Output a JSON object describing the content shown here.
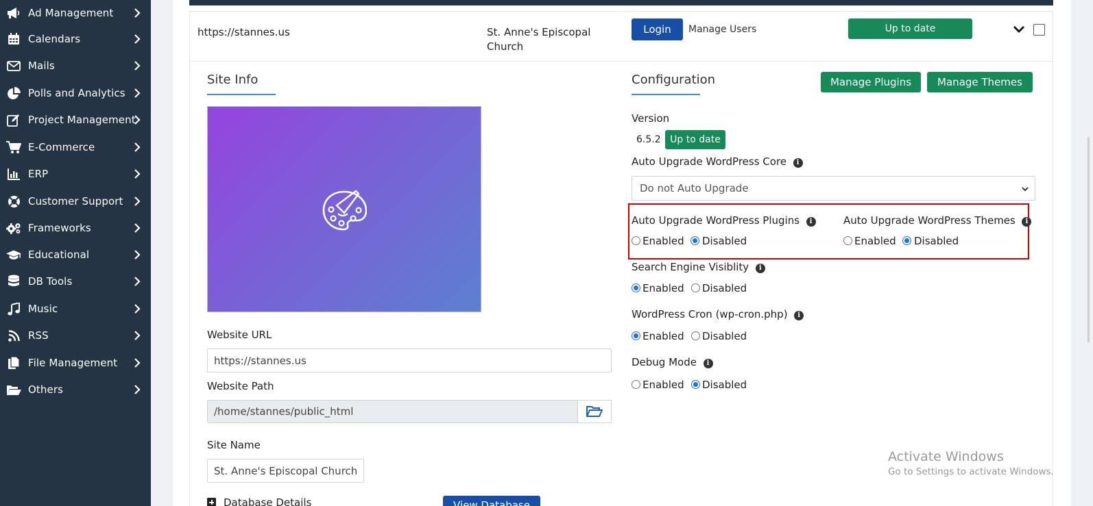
{
  "sidebar": {
    "items": [
      {
        "label": "Ad Management",
        "icon": "megaphone-icon"
      },
      {
        "label": "Calendars",
        "icon": "calendar-icon"
      },
      {
        "label": "Mails",
        "icon": "envelope-icon"
      },
      {
        "label": "Polls and Analytics",
        "icon": "pie-chart-icon"
      },
      {
        "label": "Project Management",
        "icon": "edit-icon"
      },
      {
        "label": "E-Commerce",
        "icon": "cart-icon"
      },
      {
        "label": "ERP",
        "icon": "bar-chart-icon"
      },
      {
        "label": "Customer Support",
        "icon": "lifebuoy-icon"
      },
      {
        "label": "Frameworks",
        "icon": "gears-icon"
      },
      {
        "label": "Educational",
        "icon": "graduation-cap-icon"
      },
      {
        "label": "DB Tools",
        "icon": "database-icon"
      },
      {
        "label": "Music",
        "icon": "music-icon"
      },
      {
        "label": "RSS",
        "icon": "rss-icon"
      },
      {
        "label": "File Management",
        "icon": "files-icon"
      },
      {
        "label": "Others",
        "icon": "folder-open-icon"
      }
    ]
  },
  "site_row": {
    "url": "https://stannes.us",
    "name_line1": "St. Anne's Episcopal",
    "name_line2": "Church",
    "login_label": "Login",
    "manage_users_label": "Manage Users",
    "status_label": "Up to date"
  },
  "site_info": {
    "tab_title": "Site Info",
    "website_url_label": "Website URL",
    "website_url_value": "https://stannes.us",
    "website_path_label": "Website Path",
    "website_path_value": "/home/stannes/public_html",
    "site_name_label": "Site Name",
    "site_name_value": "St. Anne's Episcopal Church",
    "database_details_label": "Database Details",
    "view_database_label": "View Database"
  },
  "configuration": {
    "tab_title": "Configuration",
    "manage_plugins_label": "Manage Plugins",
    "manage_themes_label": "Manage Themes",
    "version_label": "Version",
    "version_value": "6.5.2",
    "version_status": "Up to date",
    "auto_core_label": "Auto Upgrade WordPress Core",
    "auto_core_value": "Do not Auto Upgrade",
    "auto_plugins_label": "Auto Upgrade WordPress Plugins",
    "auto_themes_label": "Auto Upgrade WordPress Themes",
    "search_engine_label": "Search Engine Visiblity",
    "cron_label": "WordPress Cron (wp-cron.php)",
    "debug_label": "Debug Mode",
    "enabled_label": "Enabled",
    "disabled_label": "Disabled",
    "info_glyph": "i",
    "settings": {
      "auto_plugins": "Disabled",
      "auto_themes": "Disabled",
      "search_engine": "Enabled",
      "cron": "Enabled",
      "debug": "Disabled"
    }
  },
  "watermark": {
    "line1": "Activate Windows",
    "line2": "Go to Settings to activate Windows."
  },
  "colors": {
    "sidebar_bg": "#243444",
    "primary_blue": "#174ea6",
    "success_green": "#178a5a",
    "highlight_red": "#d40000",
    "radio_blue": "#1a73e8"
  }
}
